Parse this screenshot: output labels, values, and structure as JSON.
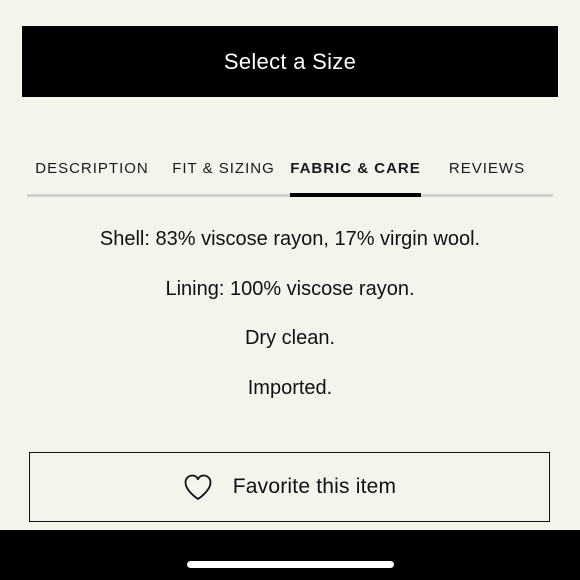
{
  "size_button": {
    "label": "Select a Size"
  },
  "tabs": [
    {
      "label": "DESCRIPTION",
      "active": false
    },
    {
      "label": "FIT & SIZING",
      "active": false
    },
    {
      "label": "FABRIC & CARE",
      "active": true
    },
    {
      "label": "REVIEWS",
      "active": false
    }
  ],
  "fabric_care": [
    "Shell: 83% viscose rayon, 17% virgin wool.",
    "Lining: 100% viscose rayon.",
    "Dry clean.",
    "Imported."
  ],
  "favorite_button": {
    "label": "Favorite this item",
    "icon": "heart-outline-icon"
  },
  "colors": {
    "background": "#f4f3ec",
    "primary_button": "#000000",
    "text": "#111111",
    "tab_rule": "#d0d0cc"
  }
}
